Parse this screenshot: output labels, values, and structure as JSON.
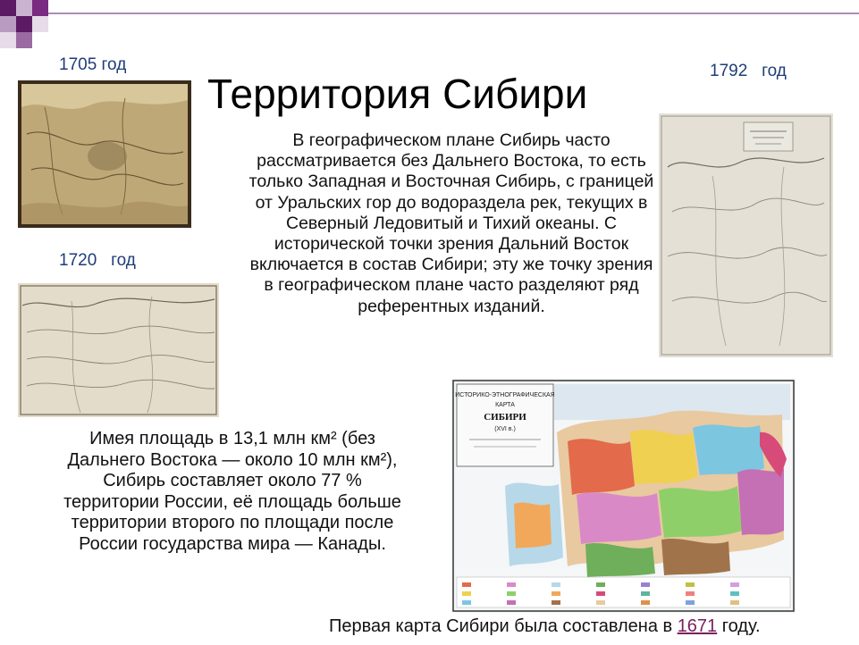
{
  "slide": {
    "title": "Территория Сибири",
    "maps": [
      {
        "year_label": "1705 год"
      },
      {
        "year_label": "1720   год"
      },
      {
        "year_label": "1792   год"
      }
    ],
    "paragraph_1": "В географическом плане Сибирь часто рассматривается без Дальнего Востока, то есть только Западная и Восточная Сибирь, с границей от Уральских гор до водораздела рек, текущих в Северный Ледовитый и Тихий океаны. С исторической точки зрения Дальний Восток включается в состав Сибири; эту же точку зрения в географическом плане часто разделяют ряд референтных изданий.",
    "paragraph_2": "Имея площадь в 13,1 млн км² (без Дальнего Востока — около 10 млн км²), Сибирь составляет около 77 % территории России, её площадь больше территории второго по площади после России государства мира — Канады.",
    "footer": {
      "prefix": "Первая карта Сибири была составлена в ",
      "link": "1671",
      "suffix": " году."
    },
    "ethno_map": {
      "header_line1": "ИСТОРИКО-ЭТНОГРАФИЧЕСКАЯ",
      "header_line2": "КАРТА",
      "header_line3": "СИБИРИ",
      "header_line4": "(XVI в.)"
    },
    "map_1792": {
      "cartouche_text": "Генеральная карта Российской империи"
    },
    "colors": {
      "year_label": "#1f3d7a",
      "link": "#7a1f5c",
      "deco_purple": "#6a1b6e",
      "deco_line": "#a98fb5"
    }
  }
}
